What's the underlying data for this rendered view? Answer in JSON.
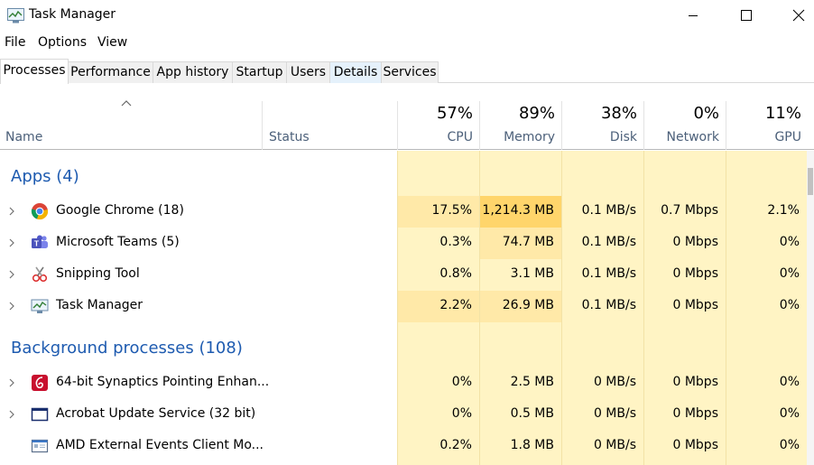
{
  "window": {
    "title": "Task Manager",
    "icon": "task-manager-icon"
  },
  "menu": [
    "File",
    "Options",
    "View"
  ],
  "tabs": [
    {
      "label": "Processes",
      "active": true
    },
    {
      "label": "Performance",
      "active": false
    },
    {
      "label": "App history",
      "active": false
    },
    {
      "label": "Startup",
      "active": false
    },
    {
      "label": "Users",
      "active": false
    },
    {
      "label": "Details",
      "active": false
    },
    {
      "label": "Services",
      "active": false
    }
  ],
  "header": {
    "name": "Name",
    "status": "Status",
    "columns": [
      {
        "pct": "57%",
        "label": "CPU"
      },
      {
        "pct": "89%",
        "label": "Memory"
      },
      {
        "pct": "38%",
        "label": "Disk"
      },
      {
        "pct": "0%",
        "label": "Network"
      },
      {
        "pct": "11%",
        "label": "GPU"
      }
    ]
  },
  "groups": [
    {
      "label": "Apps (4)",
      "rows": [
        {
          "name": "Google Chrome (18)",
          "icon": "chrome-icon",
          "expandable": true,
          "cpu": "17.5%",
          "memory": "1,214.3 MB",
          "disk": "0.1 MB/s",
          "network": "0.7 Mbps",
          "gpu": "2.1%"
        },
        {
          "name": "Microsoft Teams (5)",
          "icon": "teams-icon",
          "expandable": true,
          "cpu": "0.3%",
          "memory": "74.7 MB",
          "disk": "0.1 MB/s",
          "network": "0 Mbps",
          "gpu": "0%"
        },
        {
          "name": "Snipping Tool",
          "icon": "snipping-tool-icon",
          "expandable": true,
          "cpu": "0.8%",
          "memory": "3.1 MB",
          "disk": "0.1 MB/s",
          "network": "0 Mbps",
          "gpu": "0%"
        },
        {
          "name": "Task Manager",
          "icon": "task-manager-icon",
          "expandable": true,
          "cpu": "2.2%",
          "memory": "26.9 MB",
          "disk": "0.1 MB/s",
          "network": "0 Mbps",
          "gpu": "0%"
        }
      ]
    },
    {
      "label": "Background processes (108)",
      "rows": [
        {
          "name": "64-bit Synaptics Pointing Enhan...",
          "icon": "synaptics-icon",
          "expandable": true,
          "cpu": "0%",
          "memory": "2.5 MB",
          "disk": "0 MB/s",
          "network": "0 Mbps",
          "gpu": "0%"
        },
        {
          "name": "Acrobat Update Service (32 bit)",
          "icon": "service-window-icon",
          "expandable": true,
          "cpu": "0%",
          "memory": "0.5 MB",
          "disk": "0 MB/s",
          "network": "0 Mbps",
          "gpu": "0%"
        },
        {
          "name": "AMD External Events Client Mo...",
          "icon": "app-window-icon",
          "expandable": false,
          "cpu": "0.2%",
          "memory": "1.8 MB",
          "disk": "0 MB/s",
          "network": "0 Mbps",
          "gpu": "0%"
        }
      ]
    }
  ],
  "colors": {
    "heat_light": "#fff4c4",
    "heat_medium": "#ffe9a8",
    "heat_strong": "#ffd56b",
    "group_text": "#1e5bb0",
    "header_text": "#4c607a"
  }
}
